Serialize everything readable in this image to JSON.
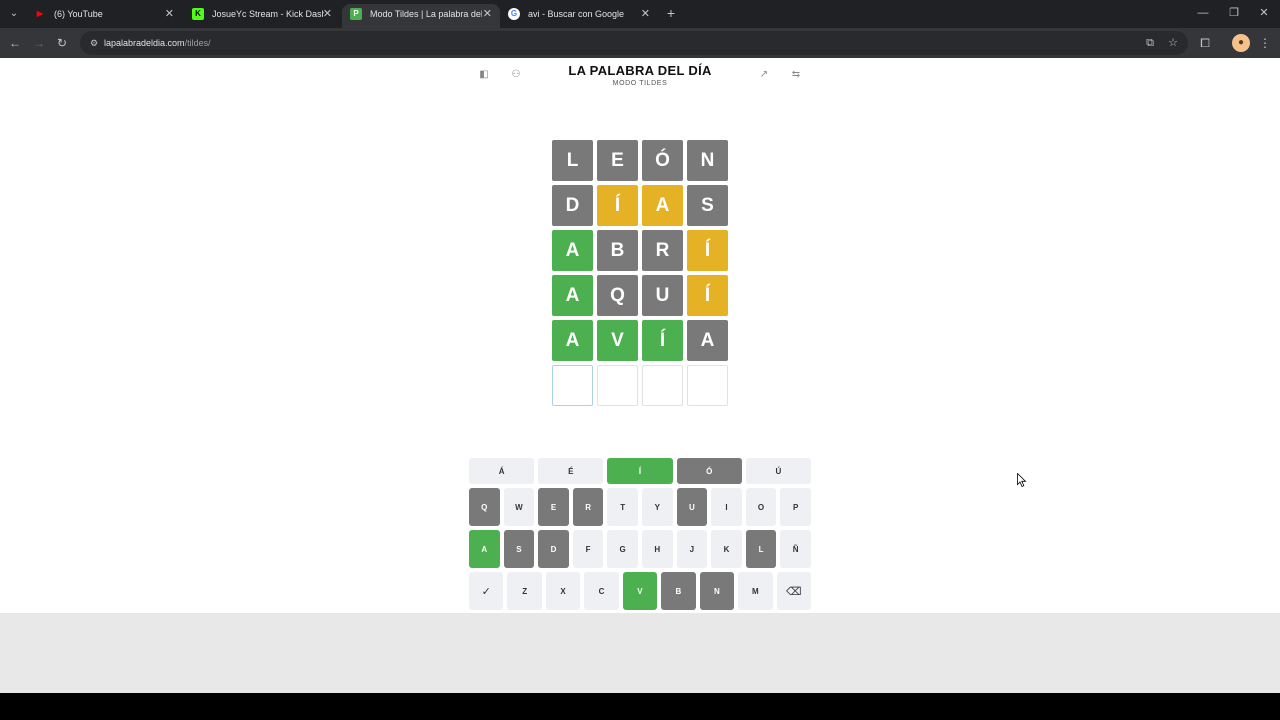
{
  "browser": {
    "tabs": [
      {
        "title": "(6) YouTube",
        "favicon_color": "#ff0000",
        "favicon_glyph": "▶"
      },
      {
        "title": "JosueYc Stream - Kick Dashboard",
        "favicon_color": "#53fc18",
        "favicon_glyph": "K"
      },
      {
        "title": "Modo Tildes | La palabra del día",
        "favicon_color": "#4cb050",
        "favicon_glyph": "P"
      },
      {
        "title": "avi - Buscar con Google",
        "favicon_color": "#ffffff",
        "favicon_glyph": "G"
      }
    ],
    "active_tab_index": 2,
    "url_host": "lapalabradeldia.com",
    "url_path": "/tildes/"
  },
  "app": {
    "title": "LA PALABRA DEL DÍA",
    "subtitle": "MODO TILDES"
  },
  "board": {
    "rows": [
      [
        {
          "l": "L",
          "s": "absent"
        },
        {
          "l": "E",
          "s": "absent"
        },
        {
          "l": "Ó",
          "s": "absent"
        },
        {
          "l": "N",
          "s": "absent"
        }
      ],
      [
        {
          "l": "D",
          "s": "absent"
        },
        {
          "l": "Í",
          "s": "present"
        },
        {
          "l": "A",
          "s": "present"
        },
        {
          "l": "S",
          "s": "absent"
        }
      ],
      [
        {
          "l": "A",
          "s": "correct"
        },
        {
          "l": "B",
          "s": "absent"
        },
        {
          "l": "R",
          "s": "absent"
        },
        {
          "l": "Í",
          "s": "present"
        }
      ],
      [
        {
          "l": "A",
          "s": "correct"
        },
        {
          "l": "Q",
          "s": "absent"
        },
        {
          "l": "U",
          "s": "absent"
        },
        {
          "l": "Í",
          "s": "present"
        }
      ],
      [
        {
          "l": "A",
          "s": "correct"
        },
        {
          "l": "V",
          "s": "correct"
        },
        {
          "l": "Í",
          "s": "correct"
        },
        {
          "l": "A",
          "s": "absent"
        }
      ],
      [
        {
          "l": "",
          "s": "empty focus"
        },
        {
          "l": "",
          "s": "empty"
        },
        {
          "l": "",
          "s": "empty"
        },
        {
          "l": "",
          "s": "empty"
        }
      ]
    ]
  },
  "keyboard": {
    "rows": [
      [
        {
          "k": "Á",
          "s": ""
        },
        {
          "k": "É",
          "s": ""
        },
        {
          "k": "Í",
          "s": "correct"
        },
        {
          "k": "Ó",
          "s": "absent"
        },
        {
          "k": "Ú",
          "s": ""
        }
      ],
      [
        {
          "k": "Q",
          "s": "absent"
        },
        {
          "k": "W",
          "s": ""
        },
        {
          "k": "E",
          "s": "absent"
        },
        {
          "k": "R",
          "s": "absent"
        },
        {
          "k": "T",
          "s": ""
        },
        {
          "k": "Y",
          "s": ""
        },
        {
          "k": "U",
          "s": "absent"
        },
        {
          "k": "I",
          "s": ""
        },
        {
          "k": "O",
          "s": ""
        },
        {
          "k": "P",
          "s": ""
        }
      ],
      [
        {
          "k": "A",
          "s": "correct"
        },
        {
          "k": "S",
          "s": "absent"
        },
        {
          "k": "D",
          "s": "absent"
        },
        {
          "k": "F",
          "s": ""
        },
        {
          "k": "G",
          "s": ""
        },
        {
          "k": "H",
          "s": ""
        },
        {
          "k": "J",
          "s": ""
        },
        {
          "k": "K",
          "s": ""
        },
        {
          "k": "L",
          "s": "absent"
        },
        {
          "k": "Ñ",
          "s": ""
        }
      ],
      [
        {
          "k": "✓",
          "s": "",
          "icon": "enter-check-icon"
        },
        {
          "k": "Z",
          "s": ""
        },
        {
          "k": "X",
          "s": ""
        },
        {
          "k": "C",
          "s": ""
        },
        {
          "k": "V",
          "s": "correct"
        },
        {
          "k": "B",
          "s": "absent"
        },
        {
          "k": "N",
          "s": "absent"
        },
        {
          "k": "M",
          "s": ""
        },
        {
          "k": "⌫",
          "s": "",
          "icon": "backspace-icon"
        }
      ]
    ]
  },
  "icons": {
    "header_left": [
      "sidebar-icon",
      "user-icon"
    ],
    "header_right": [
      "stats-icon",
      "settings-icon"
    ]
  },
  "colors": {
    "correct": "#4cb050",
    "present": "#e4b224",
    "absent": "#797979"
  }
}
